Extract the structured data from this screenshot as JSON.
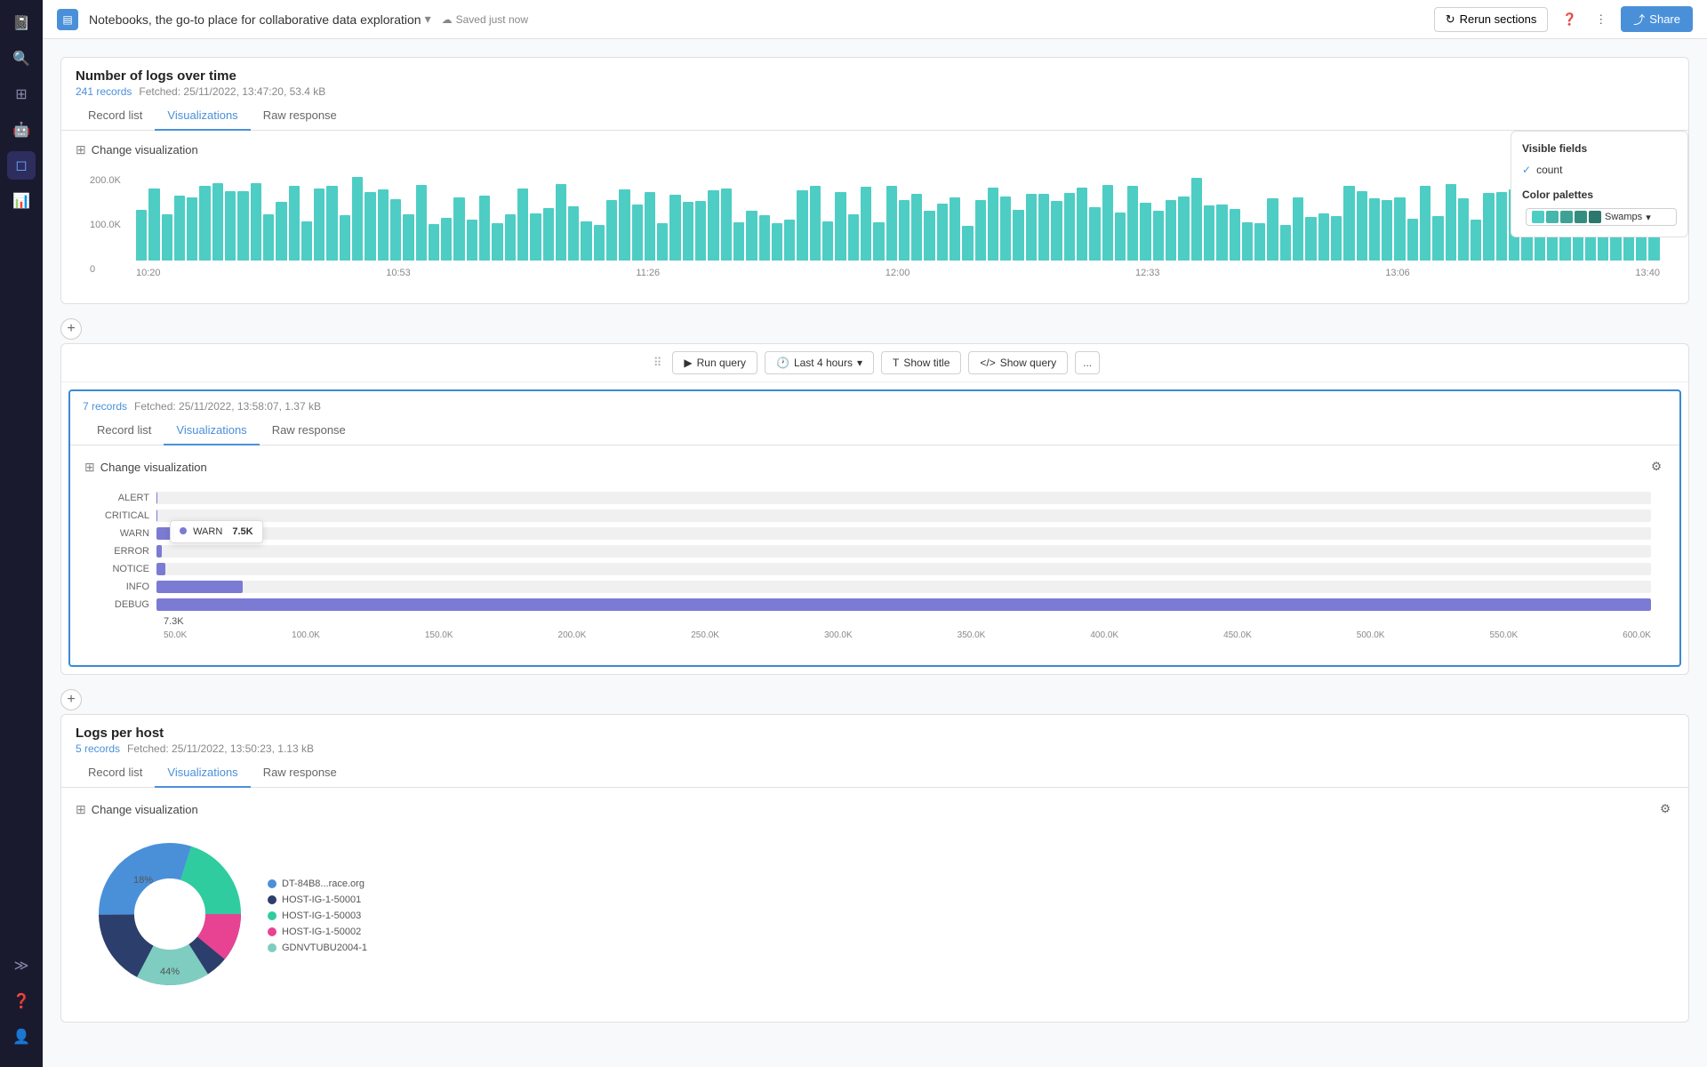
{
  "app": {
    "notebook_title": "Notebooks, the go-to place for collaborative data exploration",
    "saved_label": "Saved just now",
    "share_label": "Share",
    "rerun_label": "Rerun sections"
  },
  "sidebar": {
    "icons": [
      "grid",
      "search",
      "apps",
      "robot",
      "code",
      "chart",
      "person",
      "bell"
    ],
    "bottom_icons": [
      "chevron",
      "help",
      "user"
    ]
  },
  "section1": {
    "title": "Number of logs over time",
    "records_count": "241 records",
    "fetched": "Fetched: 25/11/2022, 13:47:20, 53.4 kB",
    "tabs": [
      "Record list",
      "Visualizations",
      "Raw response"
    ],
    "active_tab": "Visualizations",
    "viz_title": "Change visualization",
    "visible_fields_title": "Visible fields",
    "visible_fields": [
      {
        "label": "count",
        "checked": true
      }
    ],
    "color_palettes_title": "Color palettes",
    "palette_name": "Swamps",
    "x_labels": [
      "10:20",
      "10:53",
      "11:26",
      "12:00",
      "12:33",
      "13:06",
      "13:40"
    ],
    "y_labels": [
      "200.0K",
      "100.0K",
      "0"
    ]
  },
  "toolbar": {
    "run_label": "Run query",
    "time_label": "Last 4 hours",
    "title_label": "Show title",
    "query_label": "Show query",
    "more_label": "..."
  },
  "section2": {
    "records_count": "7 records",
    "fetched": "Fetched: 25/11/2022, 13:58:07, 1.37 kB",
    "tabs": [
      "Record list",
      "Visualizations",
      "Raw response"
    ],
    "active_tab": "Visualizations",
    "viz_title": "Change visualization",
    "bar_labels": [
      "ALERT",
      "CRITICAL",
      "WARN",
      "ERROR",
      "NOTICE",
      "INFO",
      "DEBUG"
    ],
    "bar_values": [
      0.2,
      0.3,
      7.3,
      2.1,
      3.5,
      35,
      600
    ],
    "bar_max": 600,
    "x_axis_labels": [
      "50.0K",
      "100.0K",
      "150.0K",
      "200.0K",
      "250.0K",
      "300.0K",
      "350.0K",
      "400.0K",
      "450.0K",
      "500.0K",
      "550.0K",
      "600.0K"
    ],
    "tooltip": {
      "label": "WARN",
      "value": "7.5K"
    },
    "bottom_label": "7.3K"
  },
  "section3": {
    "title": "Logs per host",
    "records_count": "5 records",
    "fetched": "Fetched: 25/11/2022, 13:50:23, 1.13 kB",
    "tabs": [
      "Record list",
      "Visualizations",
      "Raw response"
    ],
    "active_tab": "Visualizations",
    "viz_title": "Change visualization",
    "pie_segments": [
      {
        "label": "DT-84B8...race.org",
        "color": "#4a90d9",
        "percent": 18,
        "value": 18
      },
      {
        "label": "HOST-IG-1-50001",
        "color": "#2c3e6b",
        "percent": 44,
        "value": 44
      },
      {
        "label": "HOST-IG-1-50003",
        "color": "#2ecc9e",
        "percent": 15,
        "value": 15
      },
      {
        "label": "HOST-IG-1-50002",
        "color": "#e84393",
        "percent": 13,
        "value": 13
      },
      {
        "label": "GDNVTUBU2004-1",
        "color": "#7ecdc0",
        "percent": 10,
        "value": 10
      }
    ],
    "pie_labels": [
      "18%",
      "44%"
    ]
  }
}
